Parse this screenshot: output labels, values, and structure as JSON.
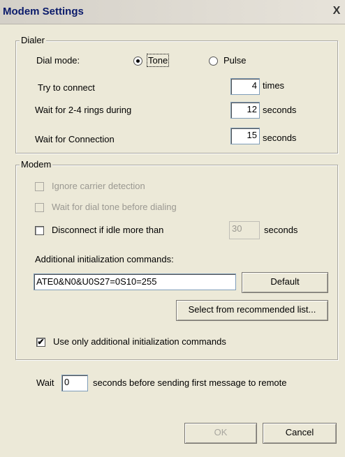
{
  "window": {
    "title": "Modem Settings",
    "close_glyph": "X"
  },
  "dialer": {
    "legend": "Dialer",
    "dial_mode_label": "Dial mode:",
    "dial_mode_options": [
      {
        "label": "Tone",
        "selected": true
      },
      {
        "label": "Pulse",
        "selected": false
      }
    ],
    "try_connect_label": "Try to connect",
    "try_connect_value": "4",
    "try_connect_unit": "times",
    "wait_rings_label": "Wait for 2-4 rings during",
    "wait_rings_value": "12",
    "wait_rings_unit": "seconds",
    "wait_connection_label": "Wait for Connection",
    "wait_connection_value": "15",
    "wait_connection_unit": "seconds"
  },
  "modem": {
    "legend": "Modem",
    "ignore_carrier_label": "Ignore carrier detection",
    "ignore_carrier_checked": false,
    "wait_dial_tone_label": "Wait for dial tone before dialing",
    "wait_dial_tone_checked": false,
    "disconnect_idle_label": "Disconnect if idle more than",
    "disconnect_idle_checked": false,
    "disconnect_idle_value": "30",
    "disconnect_idle_unit": "seconds",
    "additional_init_label": "Additional initialization commands:",
    "additional_init_value": "ATE0&N0&U0S27=0S10=255",
    "default_button": "Default",
    "select_recommended_button": "Select from recommended list...",
    "use_only_additional_label": "Use only additional initialization commands",
    "use_only_additional_checked": true,
    "check_glyph": "✔"
  },
  "footer": {
    "wait_label": "Wait",
    "wait_value": "0",
    "wait_suffix": "seconds before sending first message to remote",
    "ok_button": "OK",
    "cancel_button": "Cancel"
  }
}
